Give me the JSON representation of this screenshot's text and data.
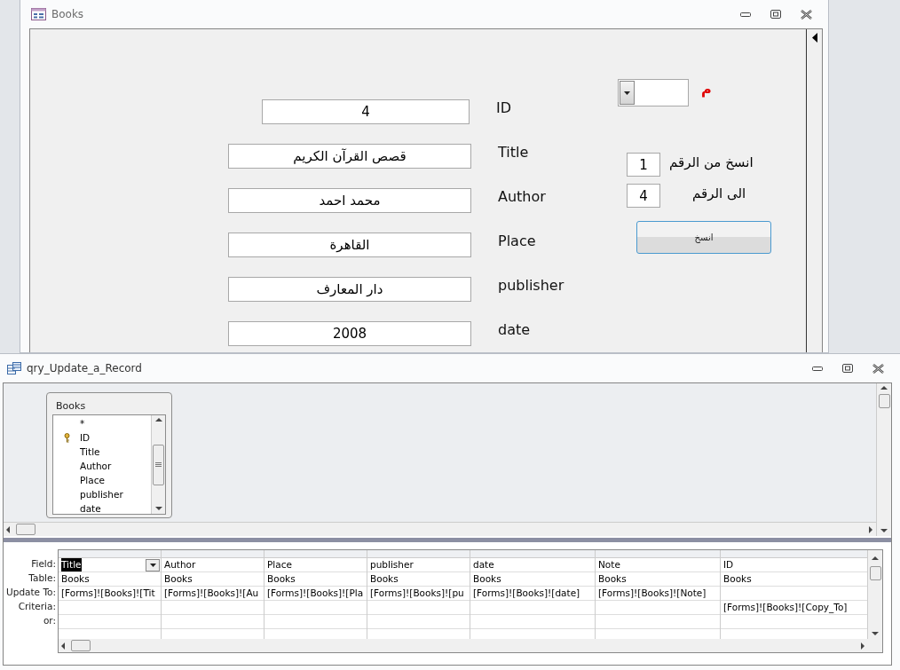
{
  "form_window": {
    "title": "Books",
    "fields": [
      {
        "label": "ID",
        "value": "4"
      },
      {
        "label": "Title",
        "value": "قصص القرآن الكريم"
      },
      {
        "label": "Author",
        "value": "محمد احمد"
      },
      {
        "label": "Place",
        "value": "القاهرة"
      },
      {
        "label": "publisher",
        "value": "دار المعارف"
      },
      {
        "label": "date",
        "value": "2008"
      }
    ],
    "copy_panel": {
      "combo_label": "م",
      "from_label": "انسخ من الرقم",
      "from_value": "1",
      "to_label": "الى الرقم",
      "to_value": "4",
      "button": "انسخ"
    }
  },
  "query_window": {
    "title": "qry_Update_a_Record",
    "table": {
      "name": "Books",
      "fields": [
        {
          "name": "*",
          "key": false
        },
        {
          "name": "ID",
          "key": true
        },
        {
          "name": "Title",
          "key": false
        },
        {
          "name": "Author",
          "key": false
        },
        {
          "name": "Place",
          "key": false
        },
        {
          "name": "publisher",
          "key": false
        },
        {
          "name": "date",
          "key": false
        }
      ]
    },
    "grid": {
      "row_labels": [
        "Field:",
        "Table:",
        "Update To:",
        "Criteria:",
        "or:"
      ],
      "columns": [
        {
          "field": "Title",
          "table": "Books",
          "update_to": "[Forms]![Books]![Tit",
          "selected": true
        },
        {
          "field": "Author",
          "table": "Books",
          "update_to": "[Forms]![Books]![Au",
          "selected": false
        },
        {
          "field": "Place",
          "table": "Books",
          "update_to": "[Forms]![Books]![Pla",
          "selected": false
        },
        {
          "field": "publisher",
          "table": "Books",
          "update_to": "[Forms]![Books]![pu",
          "selected": false
        },
        {
          "field": "date",
          "table": "Books",
          "update_to": "[Forms]![Books]![date]",
          "selected": false
        },
        {
          "field": "Note",
          "table": "Books",
          "update_to": "[Forms]![Books]![Note]",
          "selected": false
        },
        {
          "field": "ID",
          "table": "Books",
          "criteria": "[Forms]![Books]![Copy_To]",
          "selected": false
        }
      ]
    }
  }
}
